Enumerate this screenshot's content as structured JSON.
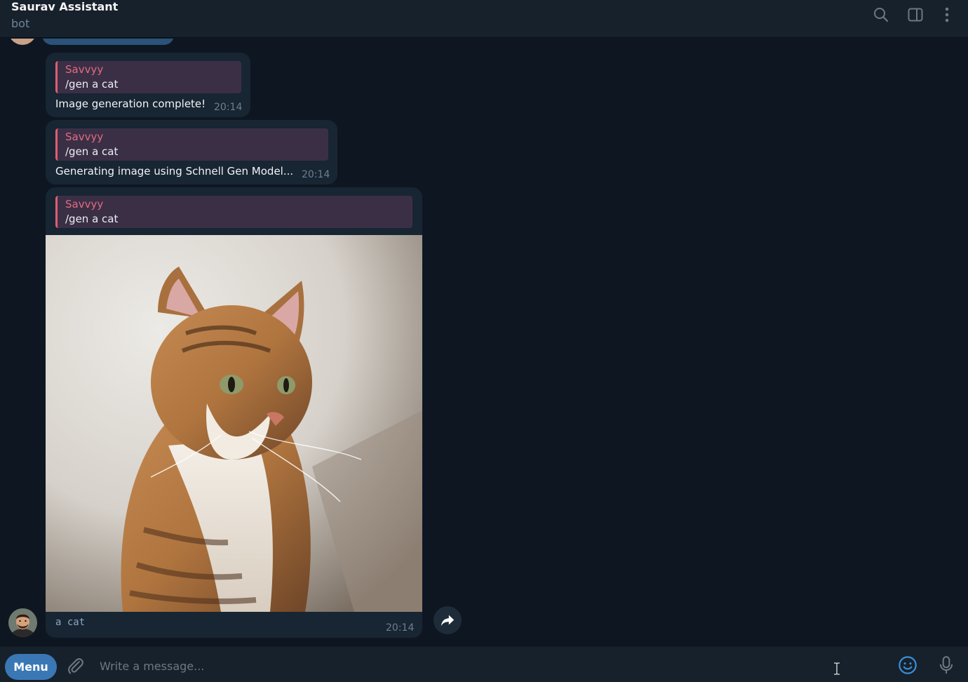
{
  "header": {
    "title": "Saurav Assistant",
    "status": "bot",
    "icons": [
      "search-icon",
      "sidebar-toggle-icon",
      "more-vertical-icon"
    ]
  },
  "messages": [
    {
      "reply": {
        "name": "Savvyy",
        "text": "/gen a cat"
      },
      "text": "Image generation complete!",
      "time": "20:14"
    },
    {
      "reply": {
        "name": "Savvyy",
        "text": "/gen a cat"
      },
      "text": "Generating image using Schnell Gen Model...",
      "time": "20:14"
    },
    {
      "reply": {
        "name": "Savvyy",
        "text": "/gen a cat"
      },
      "photo": "cat-image",
      "caption": "a cat",
      "time": "20:14"
    }
  ],
  "composer": {
    "menu_label": "Menu",
    "placeholder": "Write a message...",
    "icons": [
      "paperclip-icon",
      "emoji-icon",
      "microphone-icon"
    ]
  },
  "colors": {
    "background": "#0e1621",
    "panel": "#17212b",
    "bubble": "#182533",
    "reply_accent": "#e25d71",
    "menu_button": "#3a78b5"
  }
}
